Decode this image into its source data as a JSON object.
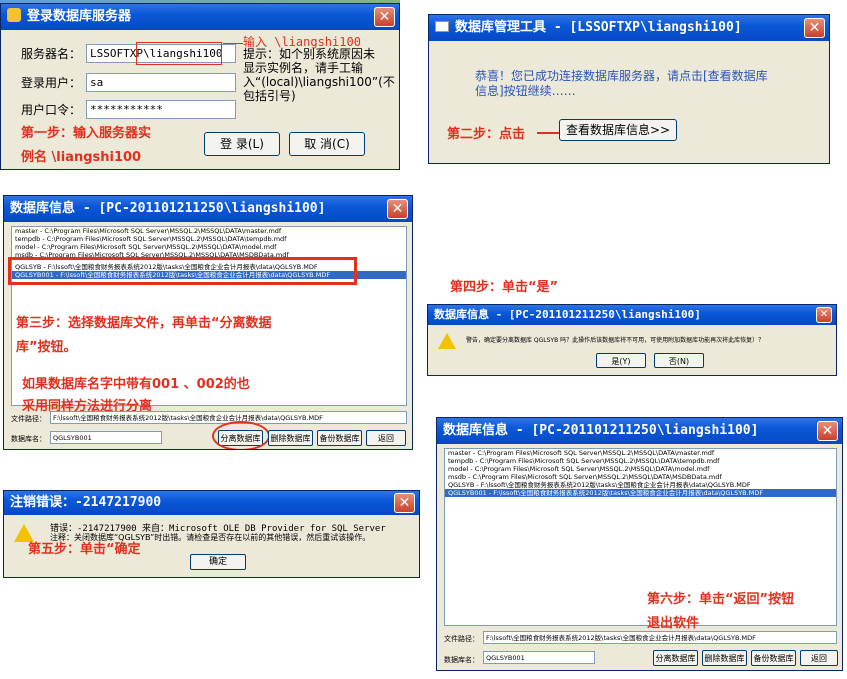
{
  "login": {
    "title": "登录数据库服务器",
    "server_label": "服务器名：",
    "server_value": "LSSOFTXP\\liangshi100",
    "user_label": "登录用户：",
    "user_value": "sa",
    "pwd_label": "用户口令：",
    "pwd_value": "***********",
    "login_btn": "登 录(L)",
    "cancel_btn": "取 消(C)",
    "annot_input": "输入 \\liangshi100",
    "hint": "提示：如个别系统原因未显示实例名，请手工输入“(local)\\liangshi100”(不包括引号)",
    "step1_line1": "第一步：输入服务器实",
    "step1_line2": "例名 \\liangshi100"
  },
  "tool": {
    "title": "数据库管理工具 - [LSSOFTXP\\liangshi100]",
    "message": "恭喜！您已成功连接数据库服务器，请点击[查看数据库信息]按钮继续……",
    "step2": "第二步：点击",
    "view_btn": "查看数据库信息>>"
  },
  "dbinfo1": {
    "title": "数据库信息 - [PC-201101211250\\liangshi100]",
    "rows": [
      "master - C:\\Program Files\\Microsoft SQL Server\\MSSQL.2\\MSSQL\\DATA\\master.mdf",
      "tempdb - C:\\Program Files\\Microsoft SQL Server\\MSSQL.2\\MSSQL\\DATA\\tempdb.mdf",
      "model - C:\\Program Files\\Microsoft SQL Server\\MSSQL.2\\MSSQL\\DATA\\model.mdf",
      "msdb - C:\\Program Files\\Microsoft SQL Server\\MSSQL.2\\MSSQL\\DATA\\MSDBData.mdf",
      "QGLSYB - F:\\lssoft\\全国粮食财务报表系统2012版\\tasks\\全国粮食企业会计月报表\\data\\QGLSYB.MDF",
      "QGLSYB001 - F:\\lssoft\\全国粮食财务报表系统2012版\\tasks\\全国粮食企业会计月报表\\data\\QGLSYB.MDF"
    ],
    "path_label": "文件路径：",
    "path_value": "F:\\lssoft\\全国粮食财务报表系统2012版\\tasks\\全国粮食企业会计月报表\\data\\QGLSYB.MDF",
    "name_label": "数据库名：",
    "name_value": "QGLSYB001",
    "btn_detach": "分离数据库",
    "btn_delete": "删除数据库",
    "btn_backup": "备份数据库",
    "btn_back": "返回",
    "step3_line1": "第三步：选择数据库文件，再单击“分离数据",
    "step3_line2": "库”按钮。",
    "note_line1": "如果数据库名字中带有001 、002的也",
    "note_line2": "采用同样方法进行分离"
  },
  "confirm": {
    "step4": "第四步：单击“是”",
    "title": "数据库信息 - [PC-201101211250\\liangshi100]",
    "message": "警告，确定要分离数据库 QGLSYB 吗？此操作后该数据库将不可用，可使用附加数据库功能再次将此库恢复）？",
    "yes_btn": "是(Y)",
    "no_btn": "否(N)"
  },
  "error": {
    "title": "注销错误：-2147217900",
    "line1": "错误：-2147217900 来自：Microsoft OLE DB Provider for SQL Server",
    "line2": "注释：关闭数据库“QGLSYB”时出错。请检查是否存在以前的其他错误，然后重试该操作。",
    "step5": "第五步：单击“确定",
    "ok_btn": "确定"
  },
  "dbinfo2": {
    "title": "数据库信息 - [PC-201101211250\\liangshi100]",
    "step6_line1": "第六步：单击“返回”按钮",
    "step6_line2": "退出软件"
  }
}
